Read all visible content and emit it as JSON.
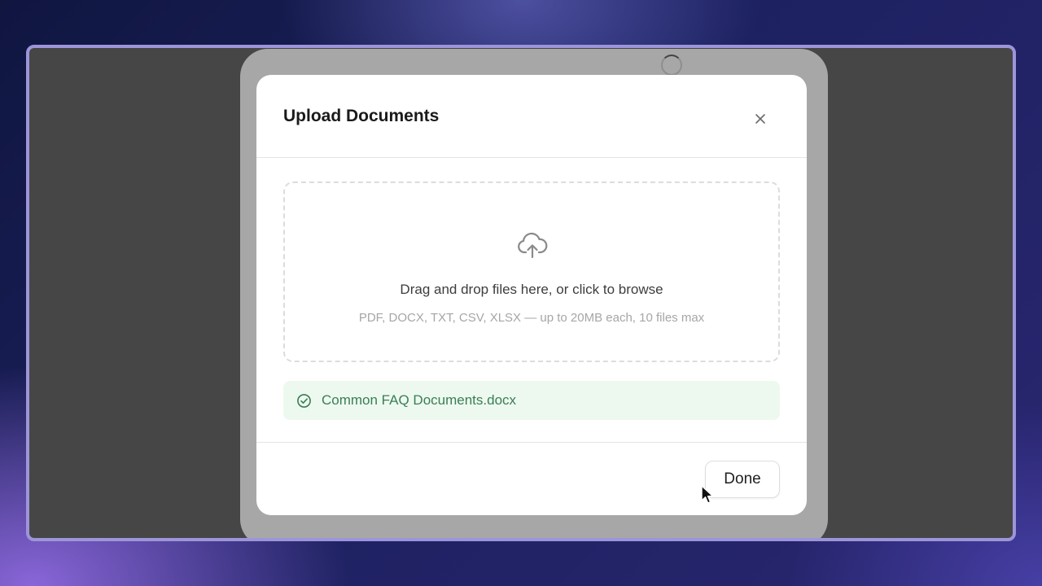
{
  "modal": {
    "title": "Upload Documents",
    "close_icon": "close-icon"
  },
  "dropzone": {
    "icon": "cloud-upload-icon",
    "title": "Drag and drop files here, or click to browse",
    "subtitle": "PDF, DOCX, TXT, CSV, XLSX — up to 20MB each, 10 files max"
  },
  "files": [
    {
      "name": "Common FAQ Documents.docx",
      "status": "uploaded",
      "icon": "check-circle-icon"
    }
  ],
  "footer": {
    "done_label": "Done"
  },
  "colors": {
    "success_text": "#3b7d57",
    "success_bg": "#edf9ee",
    "frame_border": "#9d95da",
    "backdrop": "#464646"
  }
}
